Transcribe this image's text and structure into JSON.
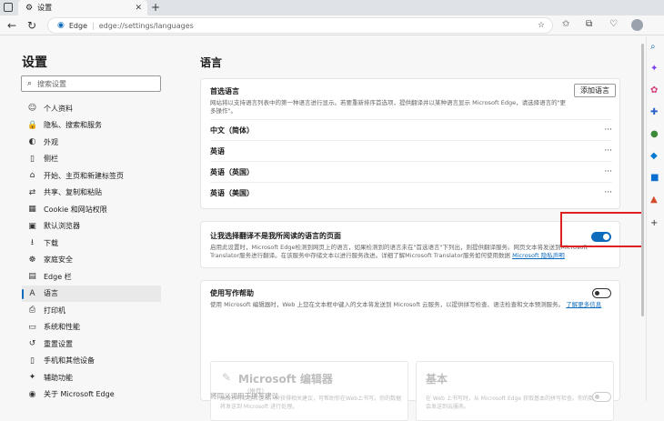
{
  "browser": {
    "tab_title": "设置",
    "tab_close": "✕",
    "new_tab": "+",
    "brand_label": "Edge",
    "url": "edge://settings/languages"
  },
  "sidebar": {
    "title": "设置",
    "search_placeholder": "搜索设置",
    "items": [
      {
        "label": "个人资料",
        "icon": "person-icon"
      },
      {
        "label": "隐私、搜索和服务",
        "icon": "lock-icon"
      },
      {
        "label": "外观",
        "icon": "appearance-icon"
      },
      {
        "label": "侧栏",
        "icon": "sidebar-icon"
      },
      {
        "label": "开始、主页和新建标签页",
        "icon": "home-icon"
      },
      {
        "label": "共享、复制和粘贴",
        "icon": "share-icon"
      },
      {
        "label": "Cookie 和网站权限",
        "icon": "cookie-icon"
      },
      {
        "label": "默认浏览器",
        "icon": "browser-icon"
      },
      {
        "label": "下载",
        "icon": "download-icon"
      },
      {
        "label": "家庭安全",
        "icon": "family-icon"
      },
      {
        "label": "Edge 栏",
        "icon": "edge-bar-icon"
      },
      {
        "label": "语言",
        "icon": "language-icon"
      },
      {
        "label": "打印机",
        "icon": "printer-icon"
      },
      {
        "label": "系统和性能",
        "icon": "system-icon"
      },
      {
        "label": "重置设置",
        "icon": "reset-icon"
      },
      {
        "label": "手机和其他设备",
        "icon": "phone-icon"
      },
      {
        "label": "辅助功能",
        "icon": "accessibility-icon"
      },
      {
        "label": "关于 Microsoft Edge",
        "icon": "edge-icon"
      }
    ],
    "active_index": 11
  },
  "main": {
    "title": "语言",
    "preferred": {
      "heading": "首选语言",
      "add_button": "添加语言",
      "description": "网站将以支持语言列表中的第一种语言进行显示。若要重新排序首选项，提供翻译并以某种语言显示 Microsoft Edge，请选择语言的\"更多操作\"。",
      "languages": [
        "中文（简体）",
        "英语",
        "英语（英国）",
        "英语（美国）"
      ],
      "more": "···"
    },
    "translate": {
      "heading": "让我选择翻译不是我所阅读的语言的页面",
      "description": "启用此设置时，Microsoft Edge检测到网页上的语言，如果检测到的语言未在\"首选语言\"下列出，则提供翻译服务。网页文本将发送到Microsoft Translator服务进行翻译。在该服务中存储文本以进行服务改进。详细了解Microsoft Translator服务如何使用数据",
      "privacy_link": "Microsoft 隐私声明",
      "enabled": true
    },
    "writing": {
      "heading": "使用写作帮助",
      "description": "使用 Microsoft 编辑器时，Web 上您在文本框中键入的文本将发送到 Microsoft 云服务，以提供拼写检查、语法检查和文本预测服务。",
      "more_link": "了解更多信息",
      "enabled": false,
      "option_editor_title": "Microsoft 编辑器",
      "option_editor_sub": "(推荐)",
      "option_editor_desc": "高级拼写检查和语法，并获得相关建议，可帮助你在Web上书写。你的数据将发送到 Microsoft 进行处理。",
      "option_basic_title": "基本",
      "option_basic_desc": "在 Web 上书写时，从 Microsoft Edge 获取基本的拼写检查。你的数据不会发送到云服务。",
      "spell_heading": "将同义词用于拼写建议",
      "spell_enabled": false
    }
  }
}
